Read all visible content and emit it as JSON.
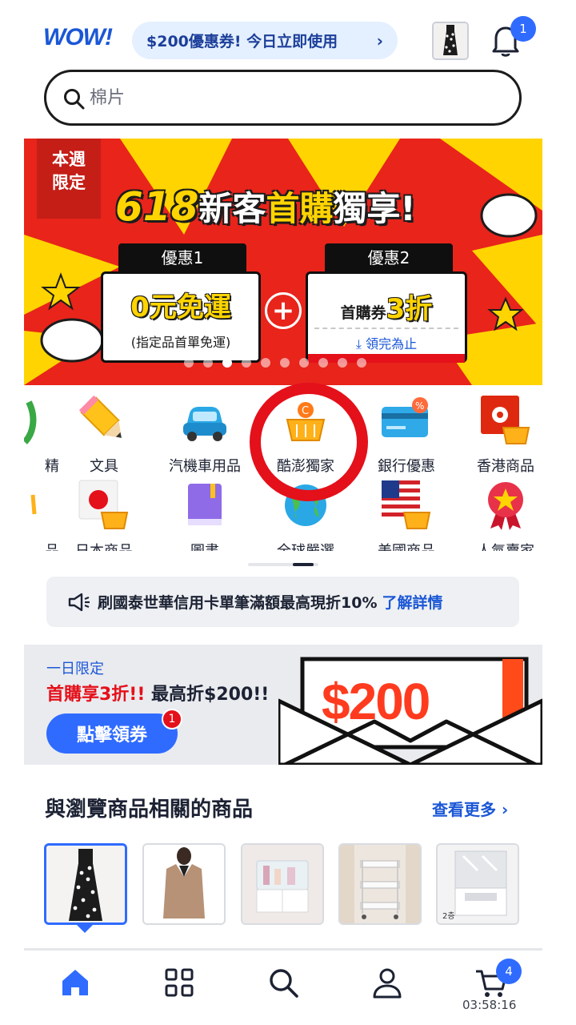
{
  "header": {
    "logo": "WOW!",
    "promo_text": "$200優惠券! 今日立即使用",
    "notification_count": "1"
  },
  "search": {
    "placeholder": "棉片"
  },
  "banner": {
    "tag_line1": "本週",
    "tag_line2": "限定",
    "headline_number": "618",
    "headline_a": "新客",
    "headline_b": "首購",
    "headline_c": "獨享!",
    "offer1_tab": "優惠1",
    "offer1_main": "0元免運",
    "offer1_sub": "(指定品首單免運)",
    "offer2_tab": "優惠2",
    "offer2_prefix": "首購券",
    "offer2_main": "3折",
    "offer2_action": "領完為止",
    "plus": "+",
    "slide_count": 10,
    "active_slide": 2
  },
  "categories": {
    "row1": [
      {
        "label": "精",
        "icon": "vegetable-icon"
      },
      {
        "label": "文具",
        "icon": "pencil-icon"
      },
      {
        "label": "汽機車用品",
        "icon": "car-icon"
      },
      {
        "label": "酷澎獨家",
        "icon": "basket-icon"
      },
      {
        "label": "銀行優惠",
        "icon": "credit-card-icon"
      },
      {
        "label": "香港商品",
        "icon": "hong-kong-flag-icon"
      }
    ],
    "row2": [
      {
        "label": "品",
        "icon": "partial-icon"
      },
      {
        "label": "日本商品",
        "icon": "japan-flag-icon"
      },
      {
        "label": "圖書",
        "icon": "book-icon"
      },
      {
        "label": "全球嚴選",
        "icon": "globe-icon"
      },
      {
        "label": "美國商品",
        "icon": "us-flag-icon"
      },
      {
        "label": "人氣賣家",
        "icon": "award-icon"
      }
    ]
  },
  "notice": {
    "text": "刷國泰世華信用卡單筆滿額最高現折10%",
    "link": "了解詳情"
  },
  "coupon": {
    "label": "一日限定",
    "headline_red": "首購享3折!!",
    "headline_rest": " 最高折$200!!",
    "button": "點擊領券",
    "button_badge": "1",
    "amount": "$200"
  },
  "related": {
    "title": "與瀏覽商品相關的商品",
    "more": "查看更多",
    "items": [
      {
        "name": "floral-dress",
        "selected": true
      },
      {
        "name": "beige-blazer",
        "selected": false
      },
      {
        "name": "cosmetic-organizer",
        "selected": false
      },
      {
        "name": "rolling-cart",
        "selected": false
      },
      {
        "name": "storage-drawer",
        "selected": false,
        "badge": "2층"
      }
    ]
  },
  "bottom_nav": {
    "items": [
      "home-icon",
      "grid-icon",
      "search-icon",
      "user-icon",
      "cart-icon"
    ],
    "cart_count": "4",
    "timer": "03:58:16"
  },
  "colors": {
    "brand_blue": "#1b57d6",
    "accent_blue": "#2f6bff",
    "red": "#e4101a",
    "banner_red": "#e8241b",
    "banner_yellow": "#ffd400"
  }
}
